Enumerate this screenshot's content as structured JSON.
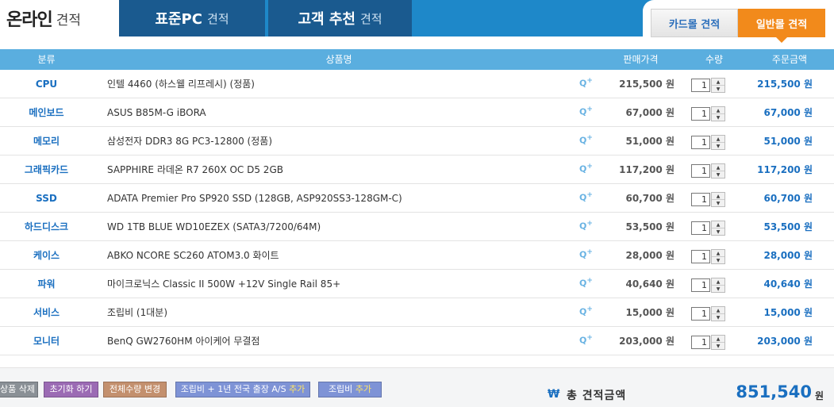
{
  "header": {
    "brand_main": "온라인",
    "brand_sub": "견적",
    "tabs": [
      {
        "main": "표준PC",
        "sub": "견적"
      },
      {
        "main": "고객 추천",
        "sub": "견적"
      }
    ],
    "switch": {
      "card": "카드몰 견적",
      "normal": "일반몰 견적"
    }
  },
  "table": {
    "headers": {
      "category": "분류",
      "name": "상품명",
      "price": "판매가격",
      "qty": "수량",
      "total": "주문금액"
    },
    "zoom_icon": "zoom-in-icon",
    "rows": [
      {
        "category": "CPU",
        "name": "인텔 4460 (하스웰 리프레시) (정품)",
        "price": "215,500 원",
        "qty": "1",
        "total": "215,500 원"
      },
      {
        "category": "메인보드",
        "name": "ASUS B85M-G iBORA",
        "price": "67,000 원",
        "qty": "1",
        "total": "67,000 원"
      },
      {
        "category": "메모리",
        "name": "삼성전자 DDR3 8G PC3-12800 (정품)",
        "price": "51,000 원",
        "qty": "1",
        "total": "51,000 원"
      },
      {
        "category": "그래픽카드",
        "name": "SAPPHIRE 라데온 R7 260X OC D5 2GB",
        "price": "117,200 원",
        "qty": "1",
        "total": "117,200 원"
      },
      {
        "category": "SSD",
        "name": "ADATA Premier Pro SP920 SSD (128GB, ASP920SS3-128GM-C)",
        "price": "60,700 원",
        "qty": "1",
        "total": "60,700 원"
      },
      {
        "category": "하드디스크",
        "name": "WD 1TB BLUE WD10EZEX (SATA3/7200/64M)",
        "price": "53,500 원",
        "qty": "1",
        "total": "53,500 원"
      },
      {
        "category": "케이스",
        "name": "ABKO NCORE SC260 ATOM3.0 화이트",
        "price": "28,000 원",
        "qty": "1",
        "total": "28,000 원"
      },
      {
        "category": "파워",
        "name": "마이크로닉스 Classic II 500W +12V Single Rail 85+",
        "price": "40,640 원",
        "qty": "1",
        "total": "40,640 원"
      },
      {
        "category": "서비스",
        "name": "조립비 (1대분)",
        "price": "15,000 원",
        "qty": "1",
        "total": "15,000 원"
      },
      {
        "category": "모니터",
        "name": "BenQ GW2760HM 아이케어 무결점",
        "price": "203,000 원",
        "qty": "1",
        "total": "203,000 원"
      }
    ]
  },
  "footer": {
    "btn_delete": "상품 삭제",
    "btn_reset": "초기화 하기",
    "btn_qty": "전체수량 변경",
    "btn_service_prefix": "조립비 + 1년 전국 출장 A/S",
    "btn_service_add": "추가",
    "btn_assembly_prefix": "조립비",
    "btn_assembly_add": "추가",
    "currency_symbol": "₩",
    "total_label": "총 견적금액",
    "total_value": "851,540",
    "total_unit": "원"
  },
  "colors": {
    "accent": "#1a6fc0",
    "tab_bar": "#1e88c9",
    "active_switch": "#f28a1b",
    "table_header": "#5aaedf"
  }
}
